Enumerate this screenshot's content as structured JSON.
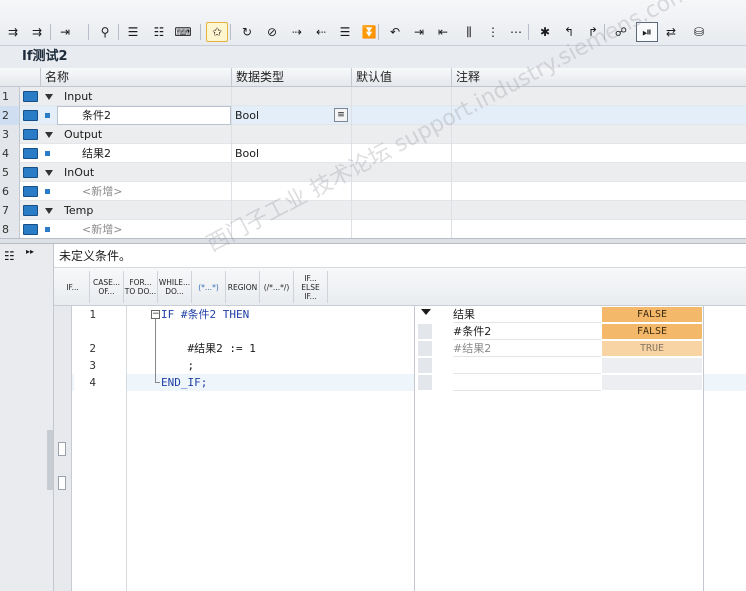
{
  "block_title": "If测试2",
  "interface": {
    "columns": [
      "名称",
      "数据类型",
      "默认值",
      "注释"
    ],
    "rows": [
      {
        "num": "1",
        "kind": "section",
        "name": "Input",
        "type": ""
      },
      {
        "num": "2",
        "kind": "var",
        "name": "条件2",
        "type": "Bool",
        "selected": true
      },
      {
        "num": "3",
        "kind": "section",
        "name": "Output",
        "type": ""
      },
      {
        "num": "4",
        "kind": "var",
        "name": "结果2",
        "type": "Bool"
      },
      {
        "num": "5",
        "kind": "section",
        "name": "InOut",
        "type": ""
      },
      {
        "num": "6",
        "kind": "new",
        "name": "<新增>",
        "type": ""
      },
      {
        "num": "7",
        "kind": "section",
        "name": "Temp",
        "type": ""
      },
      {
        "num": "8",
        "kind": "new",
        "name": "<新增>",
        "type": ""
      }
    ]
  },
  "message": "未定义条件。",
  "scl_buttons": [
    {
      "label": "IF..."
    },
    {
      "label": "CASE...\nOF..."
    },
    {
      "label": "FOR...\nTO DO..."
    },
    {
      "label": "WHILE...\nDO..."
    },
    {
      "label": "(*...*)"
    },
    {
      "label": "REGION"
    },
    {
      "label": "(/*...*/)"
    },
    {
      "label": "IF...\nELSE\nIF..."
    }
  ],
  "code": {
    "lines": [
      {
        "num": "1",
        "text": "IF #条件2 THEN"
      },
      {
        "num": "",
        "text": ""
      },
      {
        "num": "2",
        "text": "    #结果2 := 1"
      },
      {
        "num": "3",
        "text": "    ;"
      },
      {
        "num": "4",
        "text": "END_IF;"
      }
    ]
  },
  "watch": [
    {
      "name": "结果",
      "value": "FALSE",
      "state": "on"
    },
    {
      "name": "#条件2",
      "value": "FALSE",
      "state": "on"
    },
    {
      "name": "#结果2",
      "value": "TRUE",
      "state": "dim"
    },
    {
      "name": "",
      "value": "",
      "state": "empty"
    },
    {
      "name": "",
      "value": "",
      "state": "empty"
    }
  ],
  "watermark": "西门子工业 技术论坛 support.industry.siemens.com/cs",
  "colors": {
    "accent": "#2a7cc7",
    "watch_value": "#f4b86a",
    "keyword": "#1f3fa5"
  }
}
